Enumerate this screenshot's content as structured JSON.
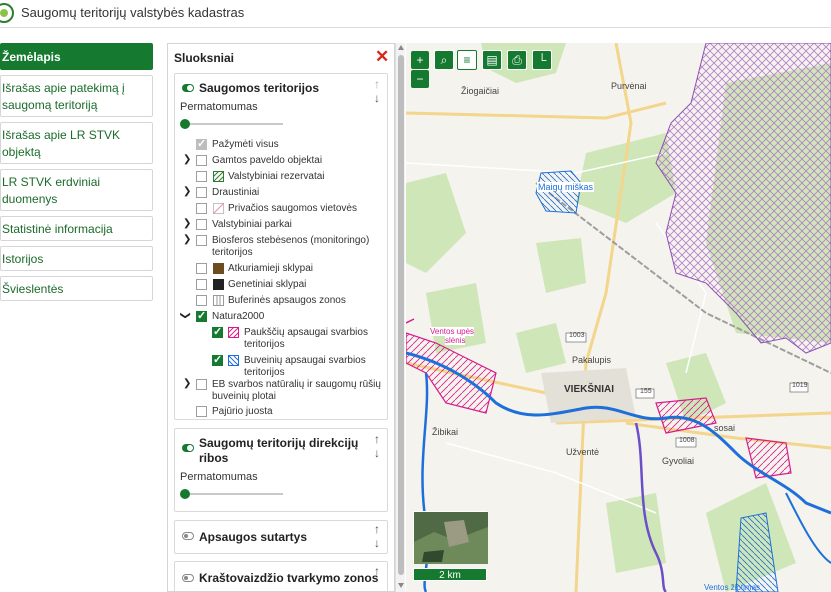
{
  "header": {
    "title": "Saugomų teritorijų valstybės kadastras"
  },
  "nav": {
    "items": [
      {
        "label": "Žemėlapis"
      },
      {
        "label": "Išrašas apie patekimą į saugomą teritoriją"
      },
      {
        "label": "Išrašas apie LR STVK objektą"
      },
      {
        "label": "LR STVK erdviniai duomenys"
      },
      {
        "label": "Statistinė informacija"
      },
      {
        "label": "Istorijos"
      },
      {
        "label": "Švieslentės"
      }
    ]
  },
  "panel": {
    "title": "Sluoksniai",
    "close": "✕",
    "opacity_label": "Permatomumas",
    "card1": {
      "title": "Saugomos teritorijos",
      "select_all": "Pažymėti visus",
      "layers": [
        "Gamtos paveldo objektai",
        "Valstybiniai rezervatai",
        "Draustiniai",
        "Privačios saugomos vietovės",
        "Valstybiniai parkai",
        "Biosferos stebėsenos (monitoringo)",
        "teritorijos",
        "Atkuriamieji sklypai",
        "Genetiniai sklypai",
        "Buferinės apsaugos zonos",
        "Natura2000",
        "Paukščių apsaugai svarbios",
        "teritorijos",
        "Buveinių apsaugai svarbios",
        "teritorijos",
        "EB svarbos natūralių ir saugomų rūšių",
        "buveinių plotai",
        "Pajūrio juosta"
      ]
    },
    "card2": {
      "title_line1": "Saugomų teritorijų direkcijų",
      "title_line2": "ribos"
    },
    "card3": {
      "title": "Apsaugos sutartys"
    },
    "card4": {
      "title": "Kraštovaizdžio tvarkymo zonos"
    }
  },
  "map": {
    "labels": {
      "ziogaiciai": "Žiogaičiai",
      "purvenai": "Purvėnai",
      "maigu": "Maigų miškas",
      "pakalupis": "Pakalupis",
      "ventos": "Ventos upės",
      "slenis": "slėnis",
      "viekšniai": "VIEKŠNIAI",
      "zibikai": "Žibikai",
      "uzvente": "Užventė",
      "gyvoliai": "Gyvoliai",
      "road1003": "1003",
      "road155": "155",
      "road1019": "1019",
      "road1008": "1008",
      "ventos_bottom": "Ventos žiotimas",
      "sosai": "sosai"
    },
    "scale": "2 km",
    "zoom_in": "+",
    "zoom_out": "−"
  }
}
